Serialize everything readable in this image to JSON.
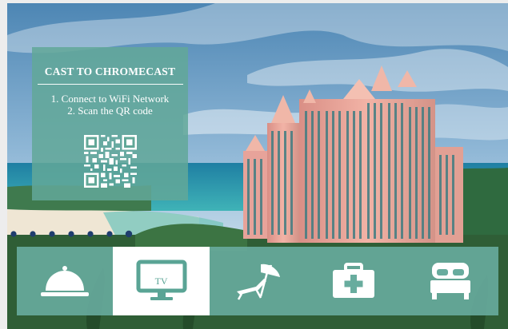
{
  "cast_panel": {
    "title": "CAST TO CHROMECAST",
    "steps": [
      "1. Connect to WiFi Network",
      "2. Scan the QR code"
    ]
  },
  "carousel": {
    "slide_count": 7,
    "active_index": 6
  },
  "menu": {
    "active": "tv",
    "tv_label": "TV",
    "items": [
      {
        "id": "room-service",
        "icon": "room-service-cloche-icon"
      },
      {
        "id": "tv",
        "icon": "tv-icon"
      },
      {
        "id": "beach",
        "icon": "beach-lounger-icon"
      },
      {
        "id": "first-aid",
        "icon": "first-aid-kit-icon"
      },
      {
        "id": "housekeeping",
        "icon": "bed-icon"
      }
    ]
  },
  "colors": {
    "panel": "#62a898",
    "menu_bar": "#68ac9e",
    "dot": "#1f3d6e",
    "icon": "#ffffff",
    "tv_icon": "#5aa495"
  }
}
